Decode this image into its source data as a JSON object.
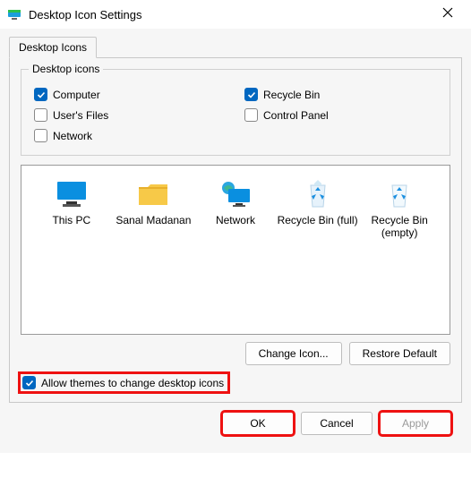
{
  "window": {
    "title": "Desktop Icon Settings"
  },
  "tab": {
    "label": "Desktop Icons"
  },
  "group": {
    "legend": "Desktop icons",
    "items": {
      "computer": {
        "label": "Computer",
        "checked": true
      },
      "recyclebin": {
        "label": "Recycle Bin",
        "checked": true
      },
      "usersfiles": {
        "label": "User's Files",
        "checked": false
      },
      "controlpanel": {
        "label": "Control Panel",
        "checked": false
      },
      "network": {
        "label": "Network",
        "checked": false
      }
    }
  },
  "icons": {
    "thispc": "This PC",
    "userfolder": "Sanal Madanan",
    "network": "Network",
    "recyclefull": "Recycle Bin (full)",
    "recycleempty": "Recycle Bin (empty)"
  },
  "buttons": {
    "changeicon": "Change Icon...",
    "restoredefault": "Restore Default",
    "ok": "OK",
    "cancel": "Cancel",
    "apply": "Apply"
  },
  "allow": {
    "label": "Allow themes to change desktop icons",
    "checked": true
  }
}
